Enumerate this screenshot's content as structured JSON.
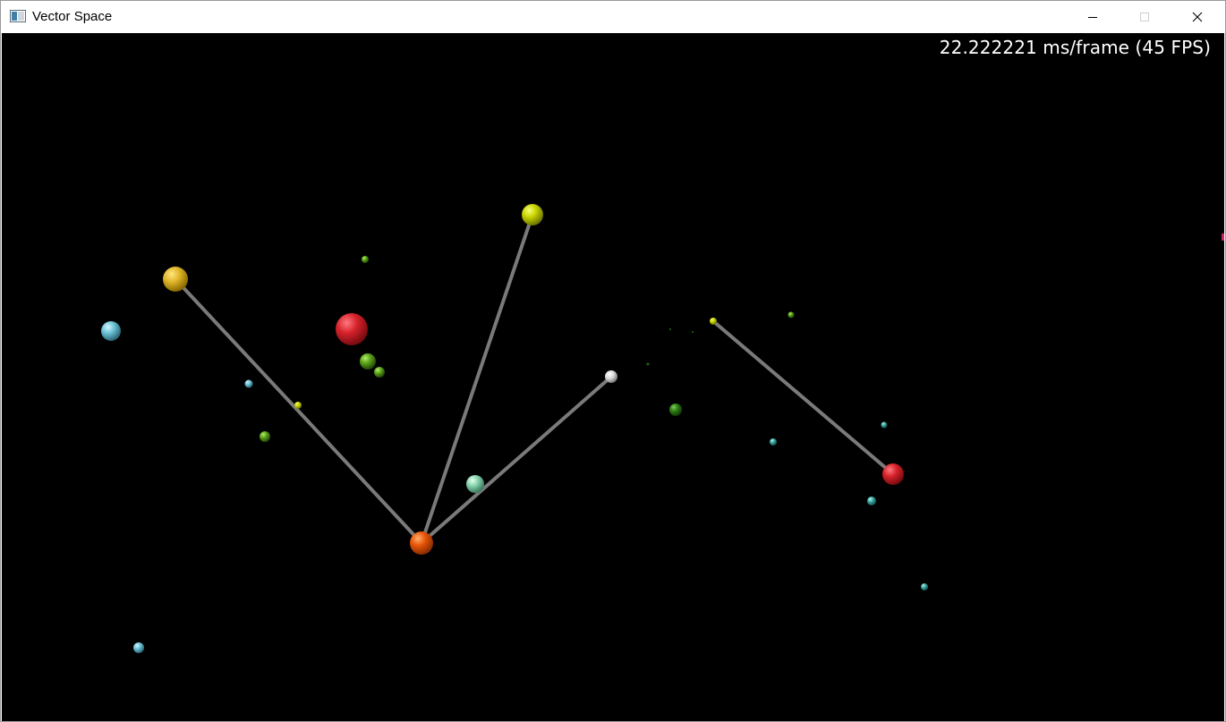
{
  "window": {
    "title": "Vector Space",
    "icon": "app-window-icon",
    "controls": [
      "minimize-icon",
      "maximize-icon",
      "close-icon"
    ]
  },
  "overlay": {
    "frame_time_text": "22.222221 ms/frame (45 FPS)"
  },
  "scene": {
    "background": "#000000",
    "edge_color": "#7a7a7a"
  }
}
